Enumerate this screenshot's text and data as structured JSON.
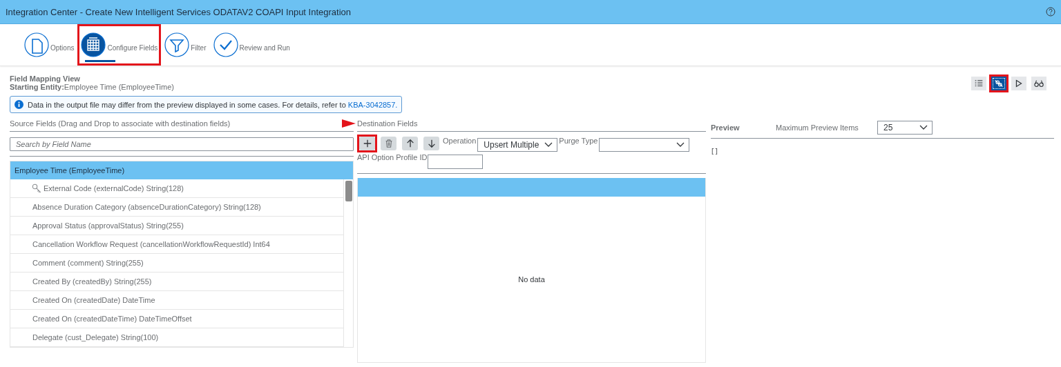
{
  "window": {
    "title": "Integration Center - Create New Intelligent Services ODATAV2 COAPI Input Integration"
  },
  "steps": [
    {
      "label": "Options",
      "kind": "document",
      "selected": false,
      "highlighted": false
    },
    {
      "label": "Configure Fields",
      "kind": "table",
      "selected": true,
      "highlighted": true
    },
    {
      "label": "Filter",
      "kind": "filter",
      "selected": false,
      "highlighted": false
    },
    {
      "label": "Review and Run",
      "kind": "check",
      "selected": false,
      "highlighted": false
    }
  ],
  "mapping": {
    "title": "Field Mapping View",
    "entity": "**Starting Entity:**Employee Time (EmployeeTime)",
    "view_buttons": [
      {
        "kind": "list",
        "selected": false,
        "highlighted": false
      },
      {
        "kind": "mapping",
        "selected": true,
        "highlighted": true
      },
      {
        "kind": "play",
        "selected": false,
        "highlighted": false
      },
      {
        "kind": "glasses",
        "selected": false,
        "highlighted": false
      }
    ],
    "info": {
      "text": "Data in the output file may differ from the preview displayed in some cases. For details, refer to",
      "link": "KBA-3042857."
    }
  },
  "source": {
    "heading": "Source Fields (Drag and Drop to associate with destination fields)",
    "search": {
      "placeholder": "Search by Field Name"
    },
    "entity": "Employee Time (EmployeeTime)",
    "fields": [
      {
        "label": "External Code (externalCode) String(128)",
        "key": true
      },
      {
        "label": "Absence Duration Category (absenceDurationCategory) String(128)",
        "key": false
      },
      {
        "label": "Approval Status (approvalStatus) String(255)",
        "key": false
      },
      {
        "label": "Cancellation Workflow Request (cancellationWorkflowRequestId) Int64",
        "key": false
      },
      {
        "label": "Comment (comment) String(255)",
        "key": false
      },
      {
        "label": "Created By (createdBy) String(255)",
        "key": false
      },
      {
        "label": "Created On (createdDate) DateTime",
        "key": false
      },
      {
        "label": "Created On (createdDateTime) DateTimeOffset",
        "key": false
      },
      {
        "label": "Delegate (cust_Delegate) String(100)",
        "key": false
      }
    ]
  },
  "destination": {
    "heading": "Destination Fields",
    "tools": [
      {
        "kind": "add",
        "highlighted": true
      },
      {
        "kind": "delete",
        "highlighted": false
      },
      {
        "kind": "up",
        "highlighted": false
      },
      {
        "kind": "down",
        "highlighted": false
      }
    ],
    "operation": {
      "label": "Operation",
      "value": "Upsert Multiple"
    },
    "purge_type": {
      "label": "Purge Type"
    },
    "profile_id": {
      "label": "API Option Profile ID"
    },
    "empty_text": "No data"
  },
  "preview": {
    "heading": "Preview",
    "max_items_label": "Maximum Preview Items",
    "max_items": "25",
    "output": "[]"
  }
}
